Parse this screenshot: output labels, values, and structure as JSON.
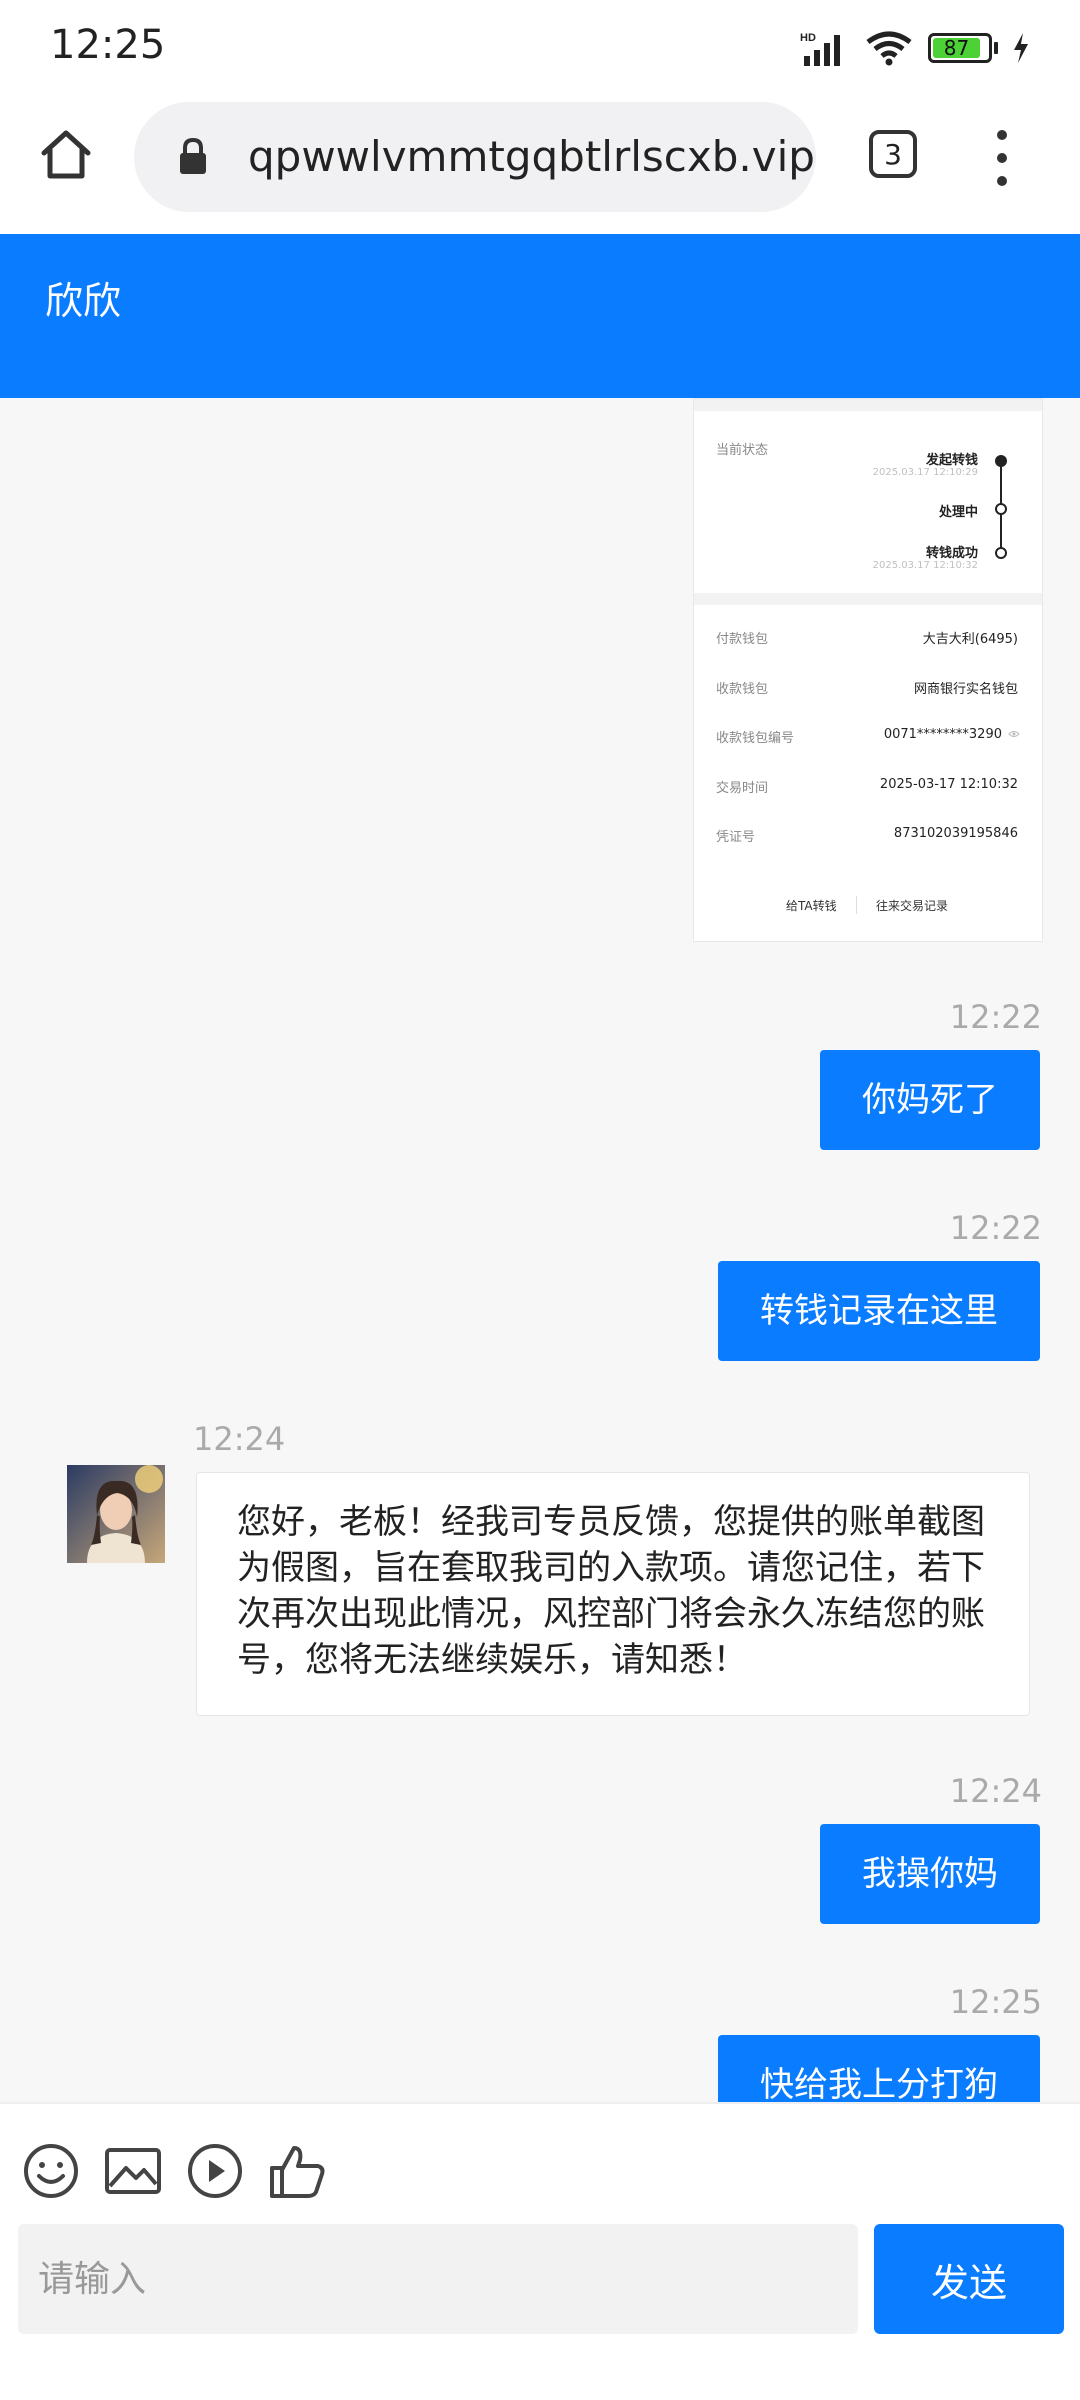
{
  "status_bar": {
    "time": "12:25",
    "network": "HD",
    "battery": "87"
  },
  "browser": {
    "url": "qpwwlvmmtgqbtlrlscxb.vip",
    "tab_count": "3"
  },
  "chat": {
    "title": "欣欣"
  },
  "receipt": {
    "status_label": "当前状态",
    "steps": [
      {
        "label": "发起转钱",
        "date": "2025.03.17 12:10:29"
      },
      {
        "label": "处理中",
        "date": ""
      },
      {
        "label": "转钱成功",
        "date": "2025.03.17 12:10:32"
      }
    ],
    "rows": [
      {
        "label": "付款钱包",
        "value": "大吉大利(6495)"
      },
      {
        "label": "收款钱包",
        "value": "网商银行实名钱包"
      },
      {
        "label": "收款钱包编号",
        "value": "0071********3290"
      },
      {
        "label": "交易时间",
        "value": "2025-03-17 12:10:32"
      },
      {
        "label": "凭证号",
        "value": "873102039195846"
      }
    ],
    "footer_left": "给TA转钱",
    "footer_right": "往来交易记录"
  },
  "messages": [
    {
      "time": "12:22",
      "text": "你妈死了",
      "direction": "out"
    },
    {
      "time": "12:22",
      "text": "转钱记录在这里",
      "direction": "out"
    },
    {
      "time": "12:24",
      "text": "您好，老板！经我司专员反馈，您提供的账单截图为假图，旨在套取我司的入款项。请您记住，若下次再次出现此情况，风控部门将会永久冻结您的账号，您将无法继续娱乐，请知悉！",
      "direction": "in"
    },
    {
      "time": "12:24",
      "text": "我操你妈",
      "direction": "out"
    },
    {
      "time": "12:25",
      "text": "快给我上分打狗",
      "direction": "out"
    }
  ],
  "composer": {
    "tools": [
      "emoji-icon",
      "image-icon",
      "video-icon",
      "thumbs-up-icon"
    ],
    "placeholder": "请输入",
    "send_label": "发送"
  }
}
